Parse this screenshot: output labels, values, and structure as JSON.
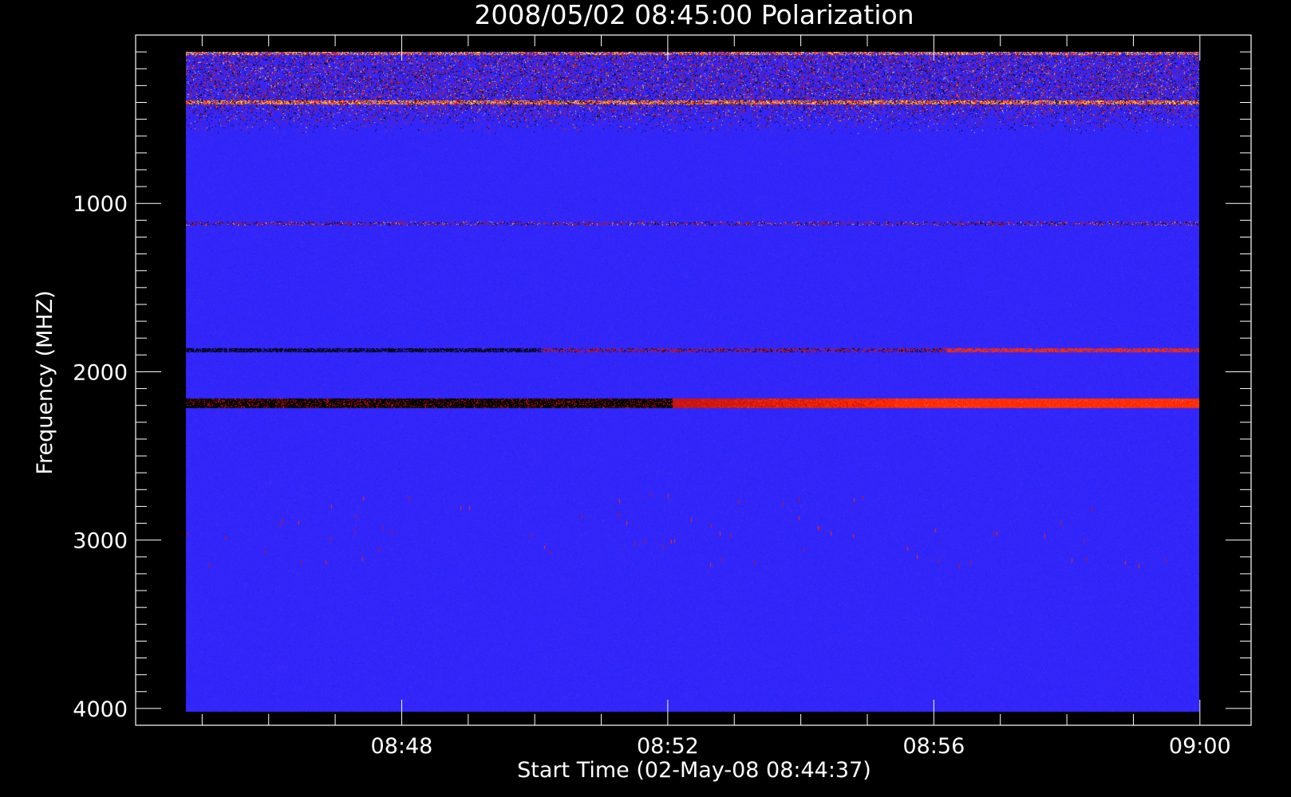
{
  "chart_data": {
    "type": "heatmap",
    "title": "2008/05/02 08:45:00 Polarization",
    "xlabel": "Start Time (02-May-08 08:44:37)",
    "ylabel": "Frequency (MHZ)",
    "x_tick_labels": [
      "08:48",
      "08:52",
      "08:56",
      "09:00"
    ],
    "x_ticks_minutes_after_start": [
      3.38,
      7.38,
      11.38,
      15.38
    ],
    "x_range_minutes_after_start": [
      -0.62,
      16.15
    ],
    "x_data_range_minutes_after_start": [
      0.14,
      15.38
    ],
    "y_tick_labels": [
      "1000",
      "2000",
      "3000",
      "4000"
    ],
    "y_ticks": [
      1000,
      2000,
      3000,
      4000
    ],
    "y_range_mhz": [
      0,
      4100
    ],
    "y_data_range_mhz": [
      100,
      4020
    ],
    "y_reversed": true,
    "grid": false,
    "colormap": [
      "#000000",
      "#1e1ee6",
      "#3b35ff",
      "#c81414",
      "#ff2a00",
      "#ffd060"
    ],
    "background_color": "#0a0aff",
    "features": [
      {
        "name": "noisy RFI band",
        "freq_mhz": [
          100,
          400
        ]
      },
      {
        "name": "bright interference line",
        "freq_mhz": 400
      },
      {
        "name": "interference line",
        "freq_mhz": 1120
      },
      {
        "name": "interference line",
        "freq_mhz": 1870
      },
      {
        "name": "dark-to-red band",
        "freq_mhz": [
          2160,
          2210
        ]
      }
    ]
  }
}
